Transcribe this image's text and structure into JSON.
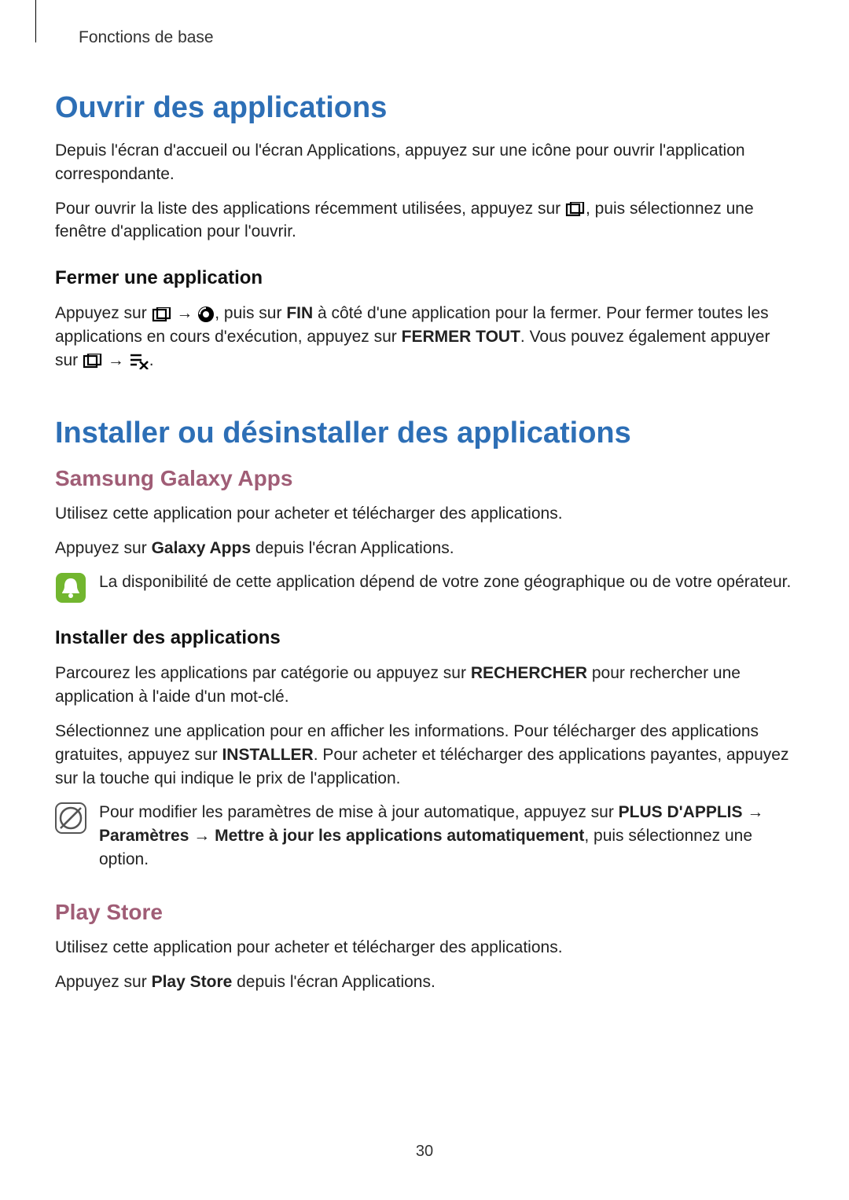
{
  "header": "Fonctions de base",
  "h1a": "Ouvrir des applications",
  "p1": "Depuis l'écran d'accueil ou l'écran Applications, appuyez sur une icône pour ouvrir l'application correspondante.",
  "p2a": "Pour ouvrir la liste des applications récemment utilisées, appuyez sur ",
  "p2b": ", puis sélectionnez une fenêtre d'application pour l'ouvrir.",
  "h2a": "Fermer une application",
  "p3a": "Appuyez sur ",
  "p3b": ", puis sur ",
  "p3_fin": "FIN",
  "p3c": " à côté d'une application pour la fermer. Pour fermer toutes les applications en cours d'exécution, appuyez sur ",
  "p3_fermer": "FERMER TOUT",
  "p3d": ". Vous pouvez également appuyer sur ",
  "p3e": ".",
  "h1b": "Installer ou désinstaller des applications",
  "h2b": "Samsung Galaxy Apps",
  "p4": "Utilisez cette application pour acheter et télécharger des applications.",
  "p5a": "Appuyez sur ",
  "p5_ga": "Galaxy Apps",
  "p5b": " depuis l'écran Applications.",
  "note1": "La disponibilité de cette application dépend de votre zone géographique ou de votre opérateur.",
  "h2c": "Installer des applications",
  "p6a": "Parcourez les applications par catégorie ou appuyez sur ",
  "p6_rech": "RECHERCHER",
  "p6b": " pour rechercher une application à l'aide d'un mot-clé.",
  "p7a": "Sélectionnez une application pour en afficher les informations. Pour télécharger des applications gratuites, appuyez sur ",
  "p7_inst": "INSTALLER",
  "p7b": ". Pour acheter et télécharger des applications payantes, appuyez sur la touche qui indique le prix de l'application.",
  "note2a": "Pour modifier les paramètres de mise à jour automatique, appuyez sur ",
  "note2_plus": "PLUS D'APPLIS",
  "note2_arrow1": " → ",
  "note2_params": "Paramètres",
  "note2_arrow2": " → ",
  "note2_maj": "Mettre à jour les applications automatiquement",
  "note2b": ", puis sélectionnez une option.",
  "h2d": "Play Store",
  "p8": "Utilisez cette application pour acheter et télécharger des applications.",
  "p9a": "Appuyez sur ",
  "p9_ps": "Play Store",
  "p9b": " depuis l'écran Applications.",
  "pagenum": "30",
  "arrow": "→"
}
